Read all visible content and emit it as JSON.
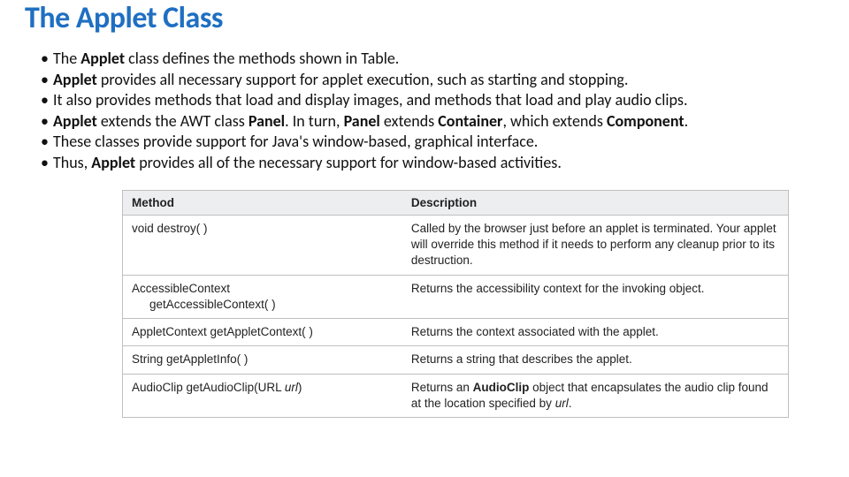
{
  "title": "The Applet Class",
  "bullets": [
    "The <b>Applet</b> class defines the methods shown in Table.",
    "<b>Applet</b> provides all necessary support for applet execution, such as starting and stopping.",
    "It also provides methods that load and display images, and methods that load and play audio clips.",
    "<b>Applet</b> extends the AWT class <b>Panel</b>. In turn, <b>Panel</b> extends <b>Container</b>, which extends <b>Component</b>.",
    "These classes provide support for Java's window-based, graphical interface.",
    "Thus, <b>Applet</b> provides all of the necessary support for window-based activities."
  ],
  "table": {
    "headers": [
      "Method",
      "Description"
    ],
    "rows": [
      {
        "method_html": "void destroy( )",
        "desc_html": "Called by the browser just before an applet is terminated. Your applet will override this method if it needs to perform any cleanup prior to its destruction."
      },
      {
        "method_html": "AccessibleContext<br><span class=\"indent\">getAccessibleContext( )</span>",
        "desc_html": "Returns the accessibility context for the invoking object."
      },
      {
        "method_html": "AppletContext getAppletContext( )",
        "desc_html": "Returns the context associated with the applet."
      },
      {
        "method_html": "String getAppletInfo( )",
        "desc_html": "Returns a string that describes the applet."
      },
      {
        "method_html": "AudioClip getAudioClip(URL <span class=\"ital\">url</span>)",
        "desc_html": "Returns an <span class=\"bold\">AudioClip</span> object that encapsulates the audio clip found at the location specified by <span class=\"ital\">url</span>."
      }
    ]
  }
}
